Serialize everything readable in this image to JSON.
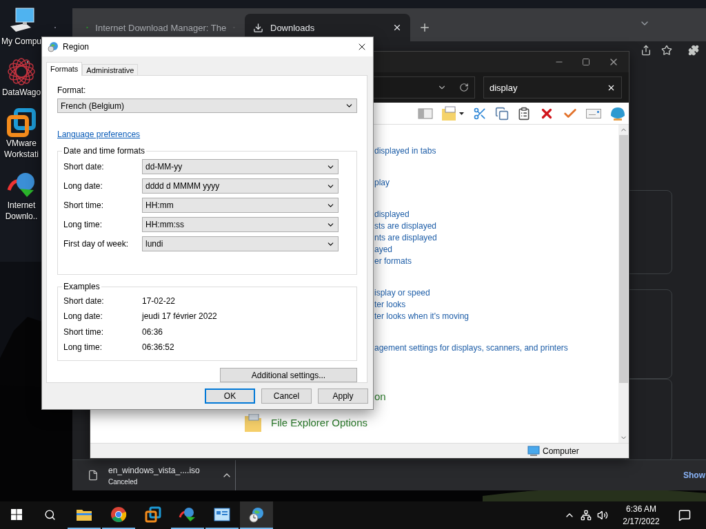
{
  "desktop": {
    "icons": [
      {
        "label": "My Compu",
        "kind": "computer"
      },
      {
        "label": "DataWago",
        "kind": "datawagon"
      },
      {
        "label": "VMware Workstati",
        "kind": "vmware"
      },
      {
        "label": "Internet Downlo..",
        "kind": "idm"
      }
    ]
  },
  "browser": {
    "tabs": [
      {
        "label": "Internet Download Manager: The",
        "selected": false,
        "kind": "idm"
      },
      {
        "label": "Downloads",
        "selected": true,
        "kind": "download"
      }
    ],
    "download_shelf": {
      "file": "en_windows_vista_....iso",
      "status": "Canceled",
      "show_all": "Show"
    }
  },
  "explorer": {
    "search": {
      "value": "display"
    },
    "results": [
      {
        "kind": "links",
        "links": [
          "displayed in tabs"
        ]
      },
      {
        "kind": "links",
        "links": [
          "play"
        ]
      },
      {
        "kind": "links",
        "links": [
          "displayed",
          "sts are displayed",
          "nts are displayed",
          "ayed",
          "er formats"
        ]
      },
      {
        "kind": "links",
        "links": [
          "isplay or speed",
          "ter looks",
          "ter looks when it's moving"
        ]
      },
      {
        "kind": "links",
        "links": [
          "agement settings for displays, scanners, and printers"
        ]
      },
      {
        "kind": "heading",
        "heading": "on"
      },
      {
        "kind": "icon_heading",
        "heading": "File Explorer Options"
      }
    ],
    "status": "Computer"
  },
  "region_dialog": {
    "title": "Region",
    "tabs": [
      {
        "label": "Formats",
        "selected": true
      },
      {
        "label": "Administrative",
        "selected": false
      }
    ],
    "format_label": "Format:",
    "format": "French (Belgium)",
    "language_link": "Language preferences",
    "formats_group": {
      "title": "Date and time formats",
      "rows": [
        {
          "label": "Short date:",
          "value": "dd-MM-yy"
        },
        {
          "label": "Long date:",
          "value": "dddd d MMMM yyyy"
        },
        {
          "label": "Short time:",
          "value": "HH:mm"
        },
        {
          "label": "Long time:",
          "value": "HH:mm:ss"
        },
        {
          "label": "First day of week:",
          "value": "lundi"
        }
      ]
    },
    "examples_group": {
      "title": "Examples",
      "rows": [
        {
          "label": "Short date:",
          "value": "17-02-22"
        },
        {
          "label": "Long date:",
          "value": "jeudi 17 février 2022"
        },
        {
          "label": "Short time:",
          "value": "06:36"
        },
        {
          "label": "Long time:",
          "value": "06:36:52"
        }
      ]
    },
    "additional_button": "Additional settings...",
    "buttons": [
      {
        "label": "OK",
        "default": true
      },
      {
        "label": "Cancel",
        "default": false
      },
      {
        "label": "Apply",
        "default": false
      }
    ]
  },
  "taskbar": {
    "apps": [
      {
        "kind": "explorer",
        "running": true,
        "selected": false
      },
      {
        "kind": "chrome",
        "running": true,
        "selected": false
      },
      {
        "kind": "vmware",
        "running": false,
        "selected": false
      },
      {
        "kind": "idm",
        "running": true,
        "selected": false
      },
      {
        "kind": "controlpanel",
        "running": true,
        "selected": false
      },
      {
        "kind": "region",
        "running": true,
        "selected": true
      }
    ],
    "time": "6:36 AM",
    "date": "2/17/2022"
  }
}
